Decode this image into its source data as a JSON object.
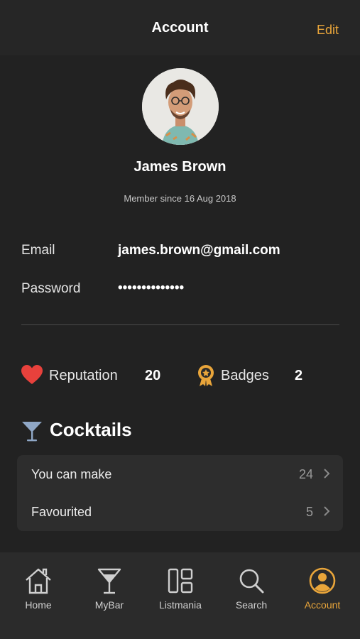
{
  "header": {
    "title": "Account",
    "edit_label": "Edit"
  },
  "profile": {
    "name": "James Brown",
    "member_since": "Member since 16 Aug 2018"
  },
  "fields": {
    "email_label": "Email",
    "email_value": "james.brown@gmail.com",
    "password_label": "Password",
    "password_value": "••••••••••••••"
  },
  "stats": {
    "reputation_label": "Reputation",
    "reputation_value": "20",
    "badges_label": "Badges",
    "badges_value": "2"
  },
  "cocktails": {
    "title": "Cocktails",
    "rows": [
      {
        "label": "You can make",
        "count": "24"
      },
      {
        "label": "Favourited",
        "count": "5"
      }
    ]
  },
  "tabs": [
    {
      "label": "Home",
      "icon": "home-icon"
    },
    {
      "label": "MyBar",
      "icon": "cocktail-glass-icon"
    },
    {
      "label": "Listmania",
      "icon": "grid-layout-icon"
    },
    {
      "label": "Search",
      "icon": "search-icon"
    },
    {
      "label": "Account",
      "icon": "account-icon"
    }
  ],
  "colors": {
    "accent": "#e9a53a",
    "heart": "#e8413c",
    "background": "#222222",
    "card": "#2d2d2d",
    "glass": "#8fa7c6"
  }
}
